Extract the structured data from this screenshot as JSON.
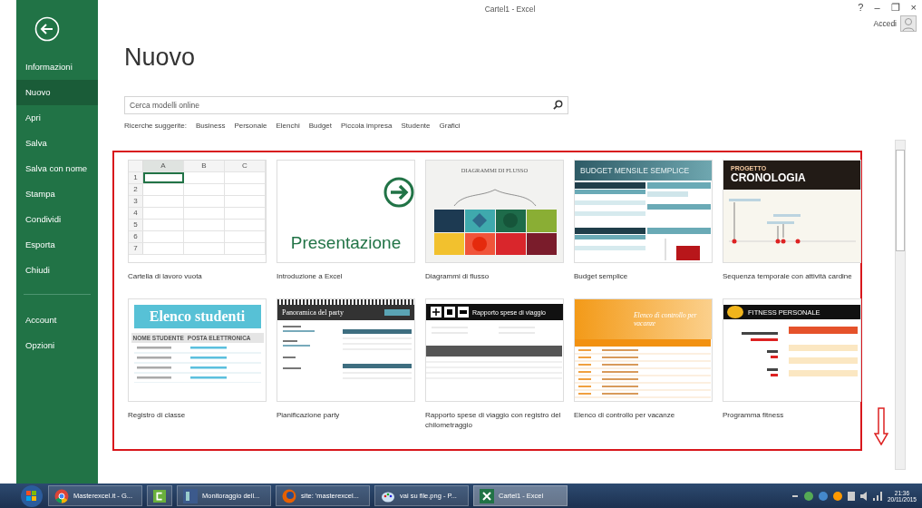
{
  "window": {
    "title": "Cartel1 - Excel",
    "controls": [
      "?",
      "–",
      "❐",
      "×"
    ],
    "account": "Accedi"
  },
  "sidebar": {
    "items": [
      {
        "label": "Informazioni",
        "selected": false
      },
      {
        "label": "Nuovo",
        "selected": true
      },
      {
        "label": "Apri",
        "selected": false
      },
      {
        "label": "Salva",
        "selected": false
      },
      {
        "label": "Salva con nome",
        "selected": false
      },
      {
        "label": "Stampa",
        "selected": false
      },
      {
        "label": "Condividi",
        "selected": false
      },
      {
        "label": "Esporta",
        "selected": false
      },
      {
        "label": "Chiudi",
        "selected": false
      }
    ],
    "bottom_items": [
      {
        "label": "Account",
        "selected": false
      },
      {
        "label": "Opzioni",
        "selected": false
      }
    ]
  },
  "heading": "Nuovo",
  "search": {
    "placeholder": "Cerca modelli online"
  },
  "suggested": {
    "label": "Ricerche suggerite:",
    "links": [
      "Business",
      "Personale",
      "Elenchi",
      "Budget",
      "Piccola impresa",
      "Studente",
      "Grafici"
    ]
  },
  "templates": [
    {
      "kind": "blank",
      "name": "Cartella di lavoro vuota",
      "columns": [
        "A",
        "B",
        "C"
      ],
      "rows": [
        "1",
        "2",
        "3",
        "4",
        "5",
        "6",
        "7"
      ]
    },
    {
      "kind": "tour",
      "name": "Introduzione a Excel",
      "title": "Presentazione"
    },
    {
      "kind": "flow",
      "name": "Diagrammi di flusso",
      "title": "DIAGRAMMI DI FLUSSO"
    },
    {
      "kind": "budget",
      "name": "Budget semplice",
      "title": "BUDGET MENSILE SEMPLICE"
    },
    {
      "kind": "timeline",
      "name": "Sequenza temporale con attività cardine",
      "kicker": "PROGETTO",
      "title": "CRONOLOGIA"
    },
    {
      "kind": "students",
      "name": "Registro di classe",
      "title": "Elenco studenti",
      "columns": [
        "NOME STUDENTE",
        "POSTA ELETTRONICA"
      ]
    },
    {
      "kind": "party",
      "name": "Pianificazione party",
      "title": "Panoramica del party"
    },
    {
      "kind": "travel",
      "name": "Rapporto spese di viaggio con registro del chilometraggio",
      "title": "Rapporto spese di viaggio"
    },
    {
      "kind": "vacation",
      "name": "Elenco di controllo per vacanze",
      "title": "Elenco di controllo per vacanze"
    },
    {
      "kind": "fitness",
      "name": "Programma fitness",
      "title": "FITNESS PERSONALE"
    }
  ],
  "taskbar": {
    "items": [
      {
        "kind": "chrome",
        "label": "Masterexcel.it - G...",
        "selected": false
      },
      {
        "kind": "camtasia",
        "selected": false
      },
      {
        "kind": "monitor",
        "label": "Monitoraggio dell...",
        "selected": false
      },
      {
        "kind": "firefox",
        "label": "site: 'masterexcel...",
        "selected": false
      },
      {
        "kind": "paint",
        "label": "vai su file.png - P...",
        "selected": false
      },
      {
        "kind": "excel",
        "label": "Cartel1 - Excel",
        "selected": true
      }
    ],
    "time": "21:36",
    "date": "20/11/2015"
  }
}
